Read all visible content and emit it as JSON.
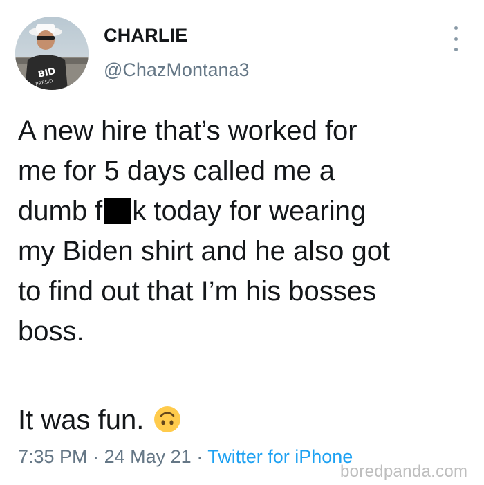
{
  "tweet": {
    "display_name": "CHARLIE",
    "handle": "@ChazMontana3",
    "body_lines": [
      "A new hire that’s worked for",
      "me for 5 days called me a",
      "dumb f",
      "k today for wearing",
      "my Biden shirt and he also got",
      "to find out that I’m his bosses",
      "boss."
    ],
    "closing": "It was fun.",
    "emoji_icon": "upside-down-face-emoji",
    "time": "7:35 PM",
    "separator": "·",
    "date": "24 May 21",
    "source": "Twitter for iPhone",
    "more_icon": "vertical-ellipsis-icon",
    "avatar_shirt_text": "BIDEN PRESIDENT"
  },
  "watermark": "boredpanda.com",
  "colors": {
    "text_primary": "#14171a",
    "text_secondary": "#657786",
    "link": "#1da1f2",
    "emoji_yellow": "#ffcb4c"
  }
}
